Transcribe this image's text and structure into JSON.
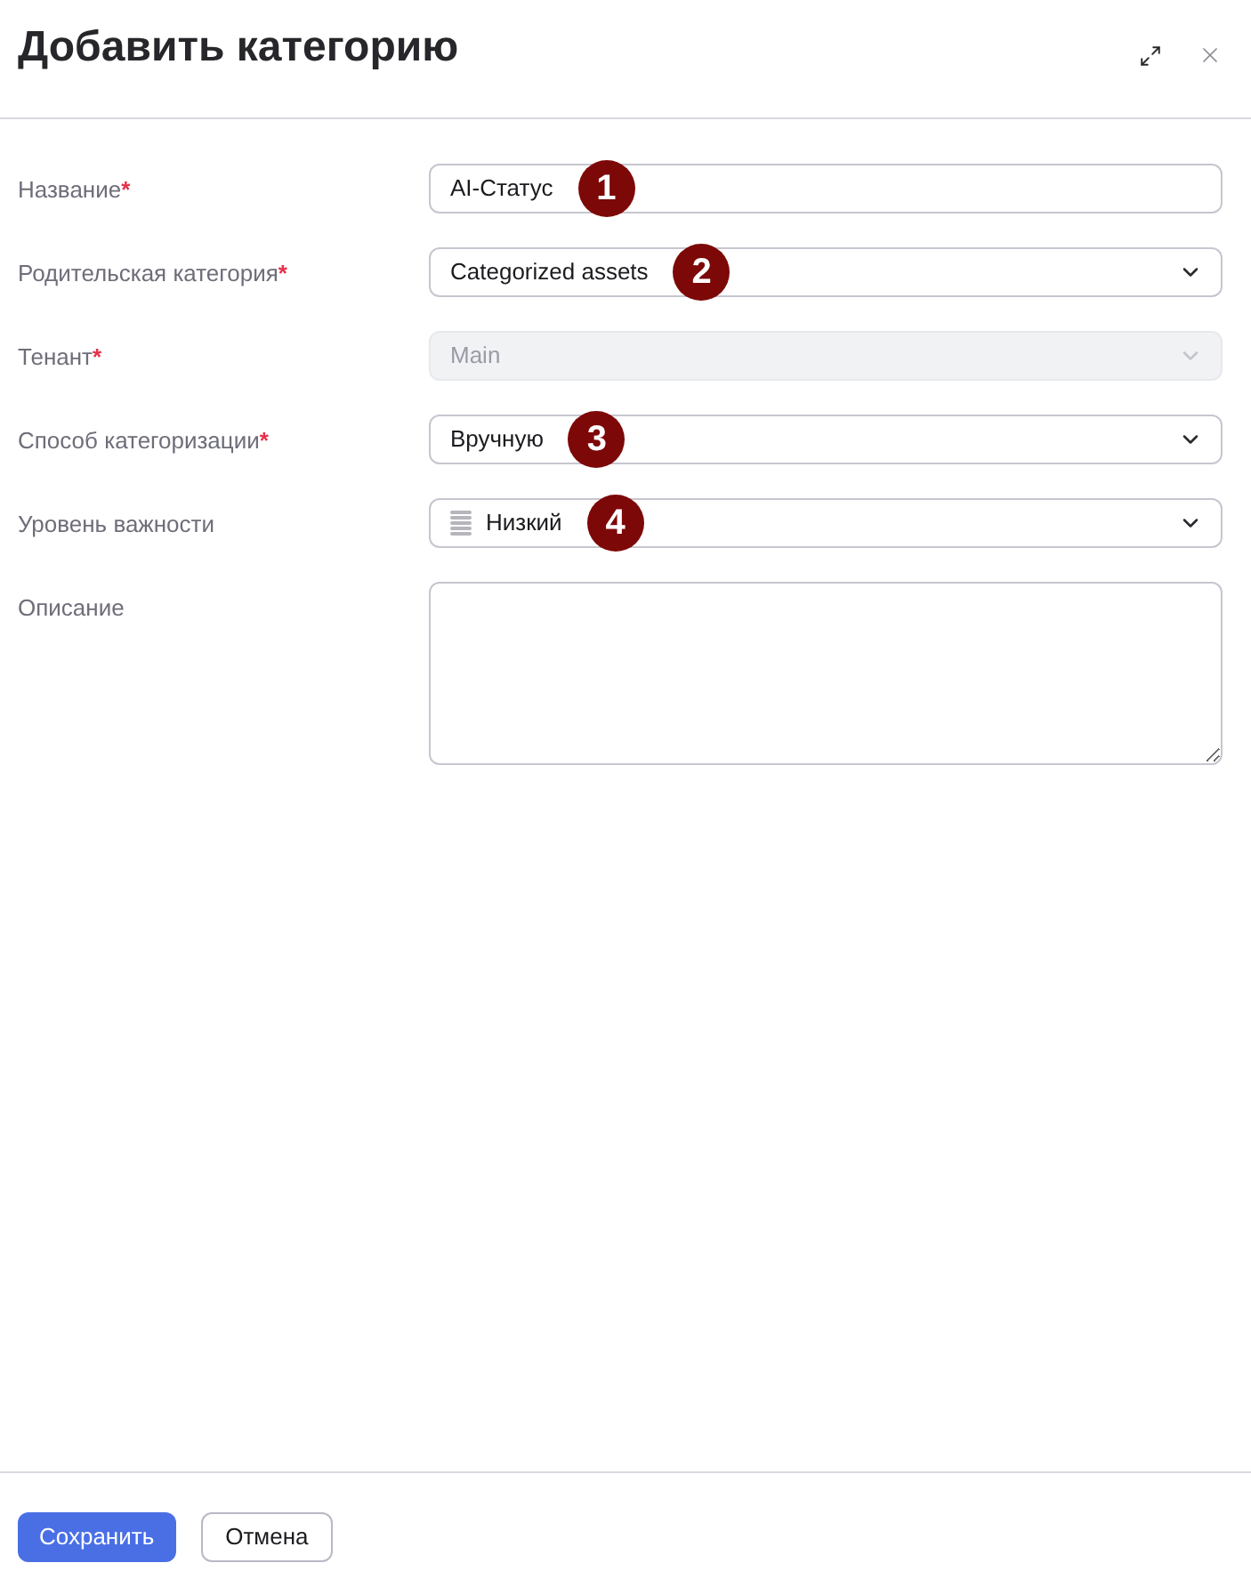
{
  "dialog": {
    "title": "Добавить категорию"
  },
  "fields": [
    {
      "label": "Название",
      "required_mark": "*",
      "kind": "text",
      "value": "AI-Статус",
      "disabled": false,
      "annotation": "1"
    },
    {
      "label": "Родительская категория",
      "required_mark": "*",
      "kind": "select",
      "value": "Categorized assets",
      "disabled": false,
      "annotation": "2"
    },
    {
      "label": "Тенант",
      "required_mark": "*",
      "kind": "select",
      "value": "Main",
      "disabled": true
    },
    {
      "label": "Способ категоризации",
      "required_mark": "*",
      "kind": "select",
      "value": "Вручную",
      "disabled": false,
      "annotation": "3"
    },
    {
      "label": "Уровень важности",
      "kind": "priority",
      "value": "Низкий",
      "disabled": false,
      "annotation": "4"
    },
    {
      "label": "Описание",
      "kind": "textarea",
      "disabled": false
    }
  ],
  "buttons": [
    {
      "label": "Сохранить",
      "kind": "primary"
    },
    {
      "label": "Отмена",
      "kind": "secondary"
    }
  ]
}
